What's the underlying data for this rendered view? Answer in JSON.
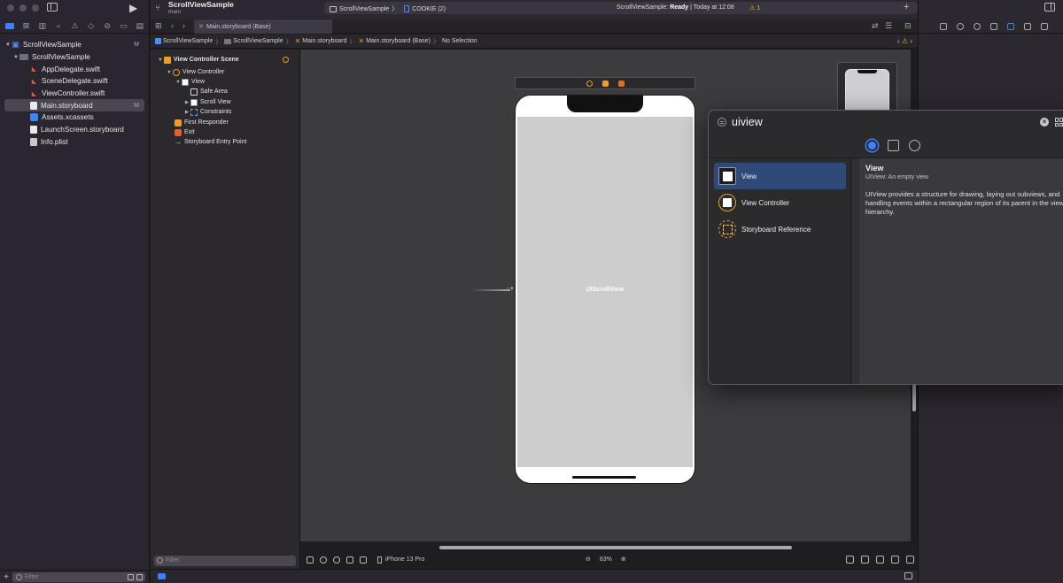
{
  "toolbar": {
    "project_title": "ScrollViewSample",
    "branch": "main",
    "scheme": "ScrollViewSample",
    "device": "COOKIE (2)",
    "status_prefix": "ScrollViewSample:",
    "status_state": "Ready",
    "status_time": "| Today at 12:08",
    "warning_count": "1",
    "run_icon": "play-icon",
    "add_icon": "plus-icon"
  },
  "tabs": {
    "active_label": "Main.storyboard (Base)"
  },
  "jump_bar": {
    "segments": [
      "ScrollViewSample",
      "ScrollViewSample",
      "Main.storyboard",
      "Main.storyboard (Base)",
      "No Selection"
    ]
  },
  "navigator": {
    "filter_placeholder": "Filter",
    "items": [
      {
        "label": "ScrollViewSample",
        "badge": "M"
      },
      {
        "label": "ScrollViewSample",
        "badge": ""
      },
      {
        "label": "AppDelegate.swift",
        "badge": ""
      },
      {
        "label": "SceneDelegate.swift",
        "badge": ""
      },
      {
        "label": "ViewController.swift",
        "badge": ""
      },
      {
        "label": "Main.storyboard",
        "badge": "M"
      },
      {
        "label": "Assets.xcassets",
        "badge": ""
      },
      {
        "label": "LaunchScreen.storyboard",
        "badge": ""
      },
      {
        "label": "Info.plist",
        "badge": ""
      }
    ]
  },
  "outline": {
    "filter_placeholder": "Filter",
    "items": [
      "View Controller Scene",
      "View Controller",
      "View",
      "Safe Area",
      "Scroll View",
      "Constraints",
      "First Responder",
      "Exit",
      "Storyboard Entry Point"
    ]
  },
  "canvas": {
    "scroll_view_label": "UIScrollView",
    "device_label": "iPhone 13 Pro",
    "zoom": "83%"
  },
  "library": {
    "search_value": "uiview",
    "items": [
      "View",
      "View Controller",
      "Storyboard Reference"
    ],
    "detail_title": "View",
    "detail_subtitle": "UIView: An empty view",
    "detail_description": "UIView provides a structure for drawing, laying out subviews, and handling events within a rectangular region of its parent in the view hierarchy.",
    "accent_color": "#3b82f6"
  }
}
